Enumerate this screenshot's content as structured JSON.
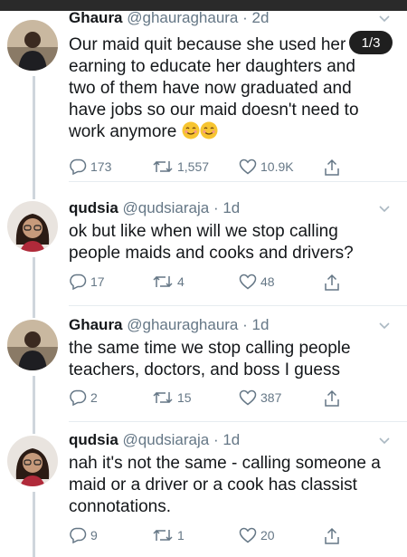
{
  "pager": {
    "label": "1/3"
  },
  "tweets": [
    {
      "name": "Ghaura",
      "handle": "@ghauraghaura",
      "time": "· 2d",
      "text_lines": [
        "Our maid quit because she used her",
        "earning to educate her daughters and",
        "two of them have now graduated and",
        "have jobs so our maid doesn't need to",
        "work anymore"
      ],
      "emoji": [
        "smiling-face-icon",
        "smiling-face-icon"
      ],
      "replies": "173",
      "retweets": "1,557",
      "likes": "10.9K"
    },
    {
      "name": "qudsia",
      "handle": "@qudsiaraja",
      "time": "· 1d",
      "text_lines": [
        "ok but like when will we stop calling",
        "people maids and cooks and drivers?"
      ],
      "replies": "17",
      "retweets": "4",
      "likes": "48"
    },
    {
      "name": "Ghaura",
      "handle": "@ghauraghaura",
      "time": "· 1d",
      "text_lines": [
        "the same time we stop calling people",
        "teachers, doctors, and boss I guess"
      ],
      "replies": "2",
      "retweets": "15",
      "likes": "387"
    },
    {
      "name": "qudsia",
      "handle": "@qudsiaraja",
      "time": "· 1d",
      "text_lines": [
        "nah it's not the same - calling someone a",
        "maid or a driver or a cook has classist",
        "connotations."
      ],
      "replies": "9",
      "retweets": "1",
      "likes": "20"
    }
  ],
  "colors": {
    "text": "#14171a",
    "secondary": "#657786",
    "thread_line": "#cfd6dc",
    "badge": "#1f1f1f"
  }
}
